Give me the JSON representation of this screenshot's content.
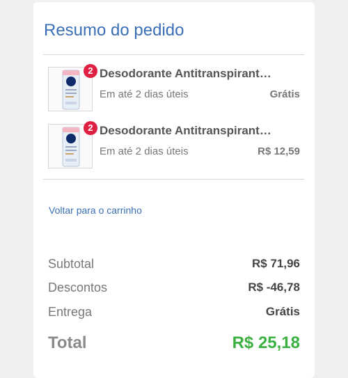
{
  "summary": {
    "title": "Resumo do pedido",
    "back_link": "Voltar para o carrinho"
  },
  "items": [
    {
      "name": "Desodorante Antitranspirante Nivea",
      "quantity": "2",
      "delivery": "Em até 2 dias úteis",
      "price": "Grátis",
      "brand": "NIVEA"
    },
    {
      "name": "Desodorante Antitranspirante Nivea",
      "quantity": "2",
      "delivery": "Em até 2 dias úteis",
      "price": "R$ 12,59",
      "brand": "NIVEA"
    }
  ],
  "totals": {
    "subtotal_label": "Subtotal",
    "subtotal_value": "R$ 71,96",
    "discount_label": "Descontos",
    "discount_value": "R$ -46,78",
    "shipping_label": "Entrega",
    "shipping_value": "Grátis",
    "total_label": "Total",
    "total_value": "R$ 25,18"
  },
  "colors": {
    "accent_blue": "#3a6fb5",
    "badge_red": "#e02043",
    "total_green": "#3cb043"
  }
}
